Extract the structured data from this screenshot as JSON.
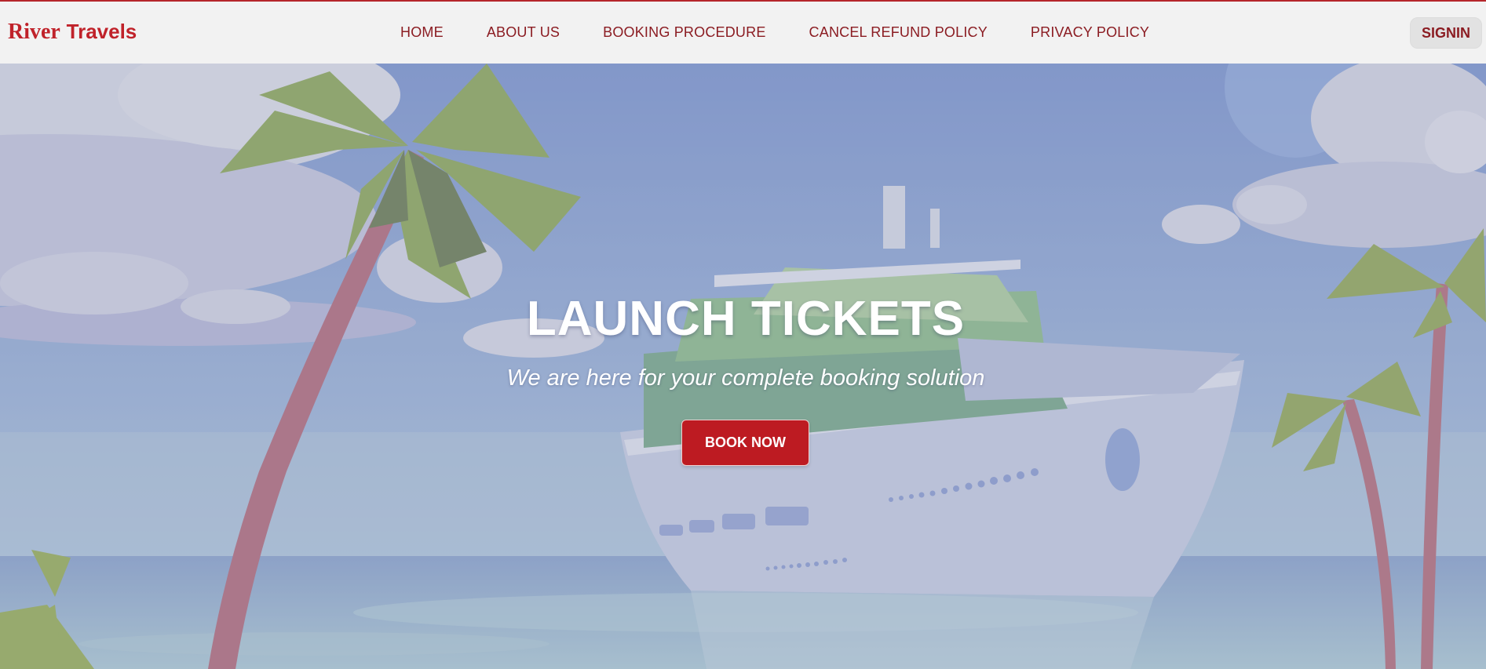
{
  "brand": {
    "part1": "River",
    "part2": "Travels",
    "color": "#c0222a"
  },
  "nav": {
    "items": [
      {
        "label": "HOME"
      },
      {
        "label": "ABOUT US"
      },
      {
        "label": "BOOKING PROCEDURE"
      },
      {
        "label": "CANCEL REFUND POLICY"
      },
      {
        "label": "PRIVACY POLICY"
      }
    ],
    "signin_label": "SIGNIN",
    "link_color": "#8b1c22"
  },
  "hero": {
    "title": "LAUNCH TICKETS",
    "subtitle": "We are here for your complete booking solution",
    "cta_label": "BOOK NOW",
    "cta_color": "#bd1b22"
  }
}
